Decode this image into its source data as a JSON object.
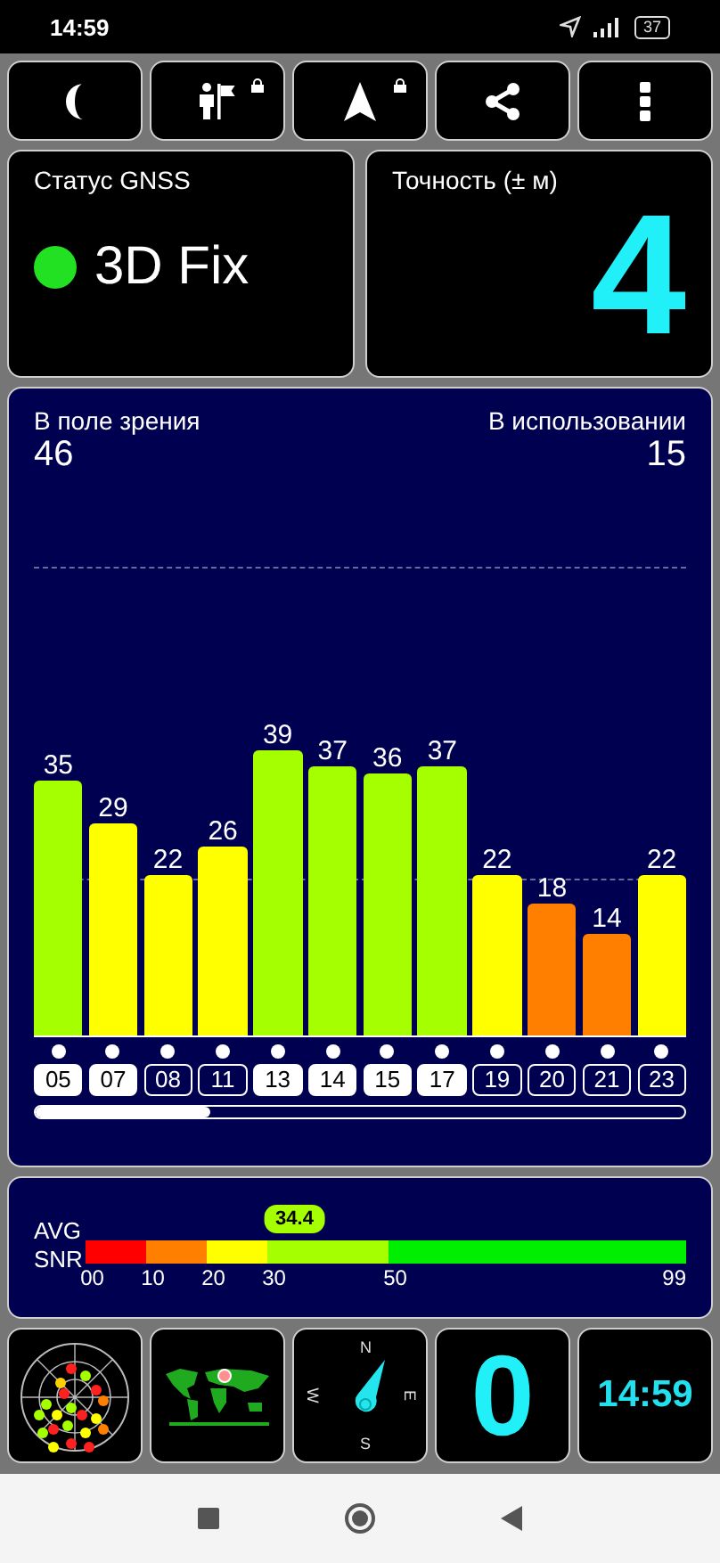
{
  "status_bar": {
    "time": "14:59",
    "battery": "37"
  },
  "toolbar": [
    {
      "kind": "moon",
      "locked": false
    },
    {
      "kind": "person-flag",
      "locked": true
    },
    {
      "kind": "navigation",
      "locked": true
    },
    {
      "kind": "share",
      "locked": false
    },
    {
      "kind": "more",
      "locked": false
    }
  ],
  "gnss_status": {
    "label": "Статус GNSS",
    "color": "#22e022",
    "value": "3D Fix"
  },
  "accuracy": {
    "label": "Точность (± м)",
    "value": "4"
  },
  "satellites_panel": {
    "in_view_label": "В поле зрения",
    "in_view": "46",
    "in_use_label": "В использовании",
    "in_use": "15",
    "chart_data": {
      "type": "bar",
      "categories": [
        "05",
        "07",
        "08",
        "11",
        "13",
        "14",
        "15",
        "17",
        "19",
        "20",
        "21",
        "23"
      ],
      "values": [
        35,
        29,
        22,
        26,
        39,
        37,
        36,
        37,
        22,
        18,
        14,
        22
      ],
      "data_labels": true
    },
    "satellites": [
      {
        "color": "#a6ff00",
        "used": true
      },
      {
        "color": "#ffff00",
        "used": true
      },
      {
        "color": "#ffff00",
        "used": false
      },
      {
        "color": "#ffff00",
        "used": false
      },
      {
        "color": "#a6ff00",
        "used": true
      },
      {
        "color": "#a6ff00",
        "used": true
      },
      {
        "color": "#a6ff00",
        "used": true
      },
      {
        "color": "#a6ff00",
        "used": true
      },
      {
        "color": "#ffff00",
        "used": false
      },
      {
        "color": "#ff8000",
        "used": false
      },
      {
        "color": "#ff8000",
        "used": false
      },
      {
        "color": "#ffff00",
        "used": false
      }
    ]
  },
  "snr": {
    "label_1": "AVG",
    "label_2": "SNR",
    "value": "34.4",
    "level": 0.347,
    "ticks": [
      "00",
      "10",
      "20",
      "30",
      "50",
      "99"
    ]
  },
  "tiles": [
    {
      "kind": "radar"
    },
    {
      "kind": "map"
    },
    {
      "kind": "compass",
      "labels": [
        "N",
        "E",
        "S",
        "W"
      ]
    },
    {
      "kind": "number",
      "value": "0"
    },
    {
      "kind": "clock",
      "value": "14:59"
    }
  ]
}
